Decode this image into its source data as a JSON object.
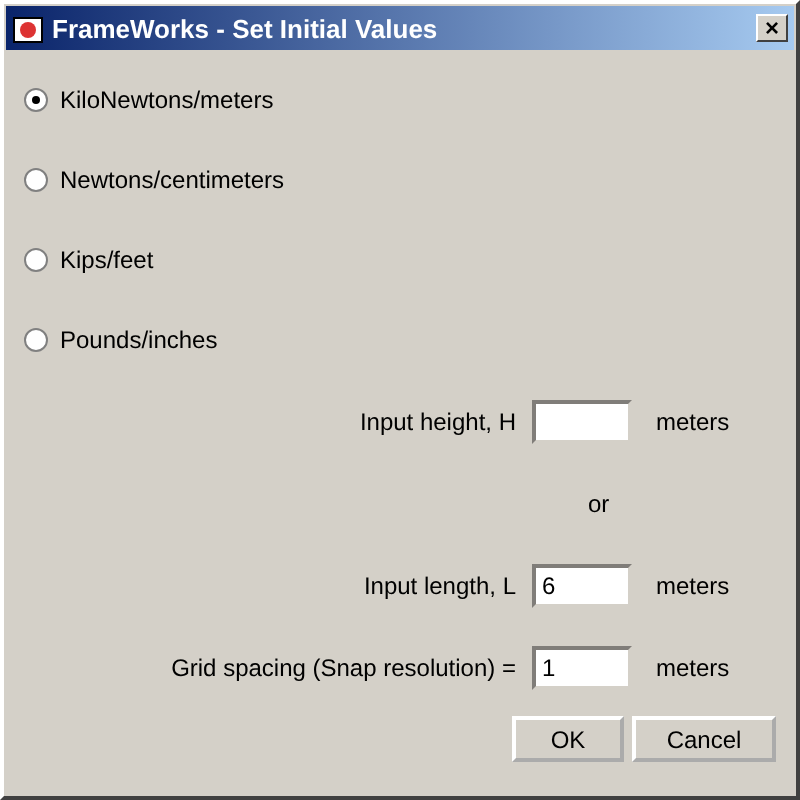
{
  "window": {
    "title": "FrameWorks - Set Initial Values",
    "close": "×"
  },
  "units": [
    {
      "label": "KiloNewtons/meters",
      "selected": true
    },
    {
      "label": "Newtons/centimeters",
      "selected": false
    },
    {
      "label": "Kips/feet",
      "selected": false
    },
    {
      "label": "Pounds/inches",
      "selected": false
    }
  ],
  "fields": [
    {
      "kind": "field",
      "label": "Input height, H",
      "unit": "meters"
    },
    {
      "kind": "separator",
      "label": "or"
    },
    {
      "kind": "field",
      "label": "Input length, L",
      "value": "6",
      "unit": "meters"
    },
    {
      "kind": "field",
      "label": "Grid spacing (Snap resolution) =",
      "value": "1",
      "unit": "meters"
    }
  ],
  "buttons": [
    "OK",
    "Cancel"
  ]
}
